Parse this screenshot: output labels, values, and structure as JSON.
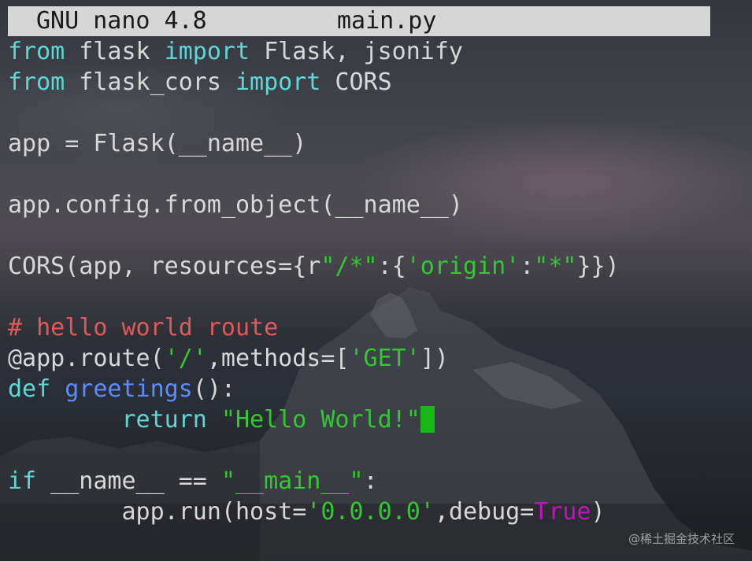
{
  "titlebar": {
    "app_version": "GNU nano 4.8",
    "filename": "main.py"
  },
  "code": {
    "lines": [
      [
        {
          "t": "from",
          "c": "kw"
        },
        {
          "t": " flask ",
          "c": "plain"
        },
        {
          "t": "import",
          "c": "kw"
        },
        {
          "t": " Flask, jsonify",
          "c": "plain"
        }
      ],
      [
        {
          "t": "from",
          "c": "kw"
        },
        {
          "t": " flask_cors ",
          "c": "plain"
        },
        {
          "t": "import",
          "c": "kw"
        },
        {
          "t": " CORS",
          "c": "plain"
        }
      ],
      [],
      [
        {
          "t": "app = Flask(__name__)",
          "c": "plain"
        }
      ],
      [],
      [
        {
          "t": "app.config.from_object(__name__)",
          "c": "plain"
        }
      ],
      [],
      [
        {
          "t": "CORS(app, resources={r",
          "c": "plain"
        },
        {
          "t": "\"/*\"",
          "c": "str"
        },
        {
          "t": ":{",
          "c": "plain"
        },
        {
          "t": "'origin'",
          "c": "str"
        },
        {
          "t": ":",
          "c": "plain"
        },
        {
          "t": "\"*\"",
          "c": "str"
        },
        {
          "t": "}})",
          "c": "plain"
        }
      ],
      [],
      [
        {
          "t": "# hello world route",
          "c": "cmt"
        }
      ],
      [
        {
          "t": "@app.route(",
          "c": "plain"
        },
        {
          "t": "'/'",
          "c": "str"
        },
        {
          "t": ",methods=[",
          "c": "plain"
        },
        {
          "t": "'GET'",
          "c": "str"
        },
        {
          "t": "])",
          "c": "plain"
        }
      ],
      [
        {
          "t": "def",
          "c": "kw"
        },
        {
          "t": " ",
          "c": "plain"
        },
        {
          "t": "greetings",
          "c": "fn"
        },
        {
          "t": "():",
          "c": "plain"
        }
      ],
      [
        {
          "t": "        ",
          "c": "plain"
        },
        {
          "t": "return",
          "c": "kw"
        },
        {
          "t": " ",
          "c": "plain"
        },
        {
          "t": "\"Hello World!\"",
          "c": "str"
        },
        {
          "t": "",
          "c": "cursor"
        }
      ],
      [],
      [
        {
          "t": "if",
          "c": "kw"
        },
        {
          "t": " __name__ == ",
          "c": "plain"
        },
        {
          "t": "\"__main__\"",
          "c": "str"
        },
        {
          "t": ":",
          "c": "plain"
        }
      ],
      [
        {
          "t": "        app.run(host=",
          "c": "plain"
        },
        {
          "t": "'0.0.0.0'",
          "c": "str"
        },
        {
          "t": ",debug=",
          "c": "plain"
        },
        {
          "t": "True",
          "c": "tru"
        },
        {
          "t": ")",
          "c": "plain"
        }
      ]
    ]
  },
  "watermark": "@稀土掘金技术社区",
  "colors": {
    "keyword": "#5fd7d7",
    "string": "#32c832",
    "comment": "#e05a5a",
    "function": "#5a8cff",
    "boolean": "#c014c0",
    "cursor": "#17b817",
    "titlebar_bg": "#d6d6d6"
  }
}
